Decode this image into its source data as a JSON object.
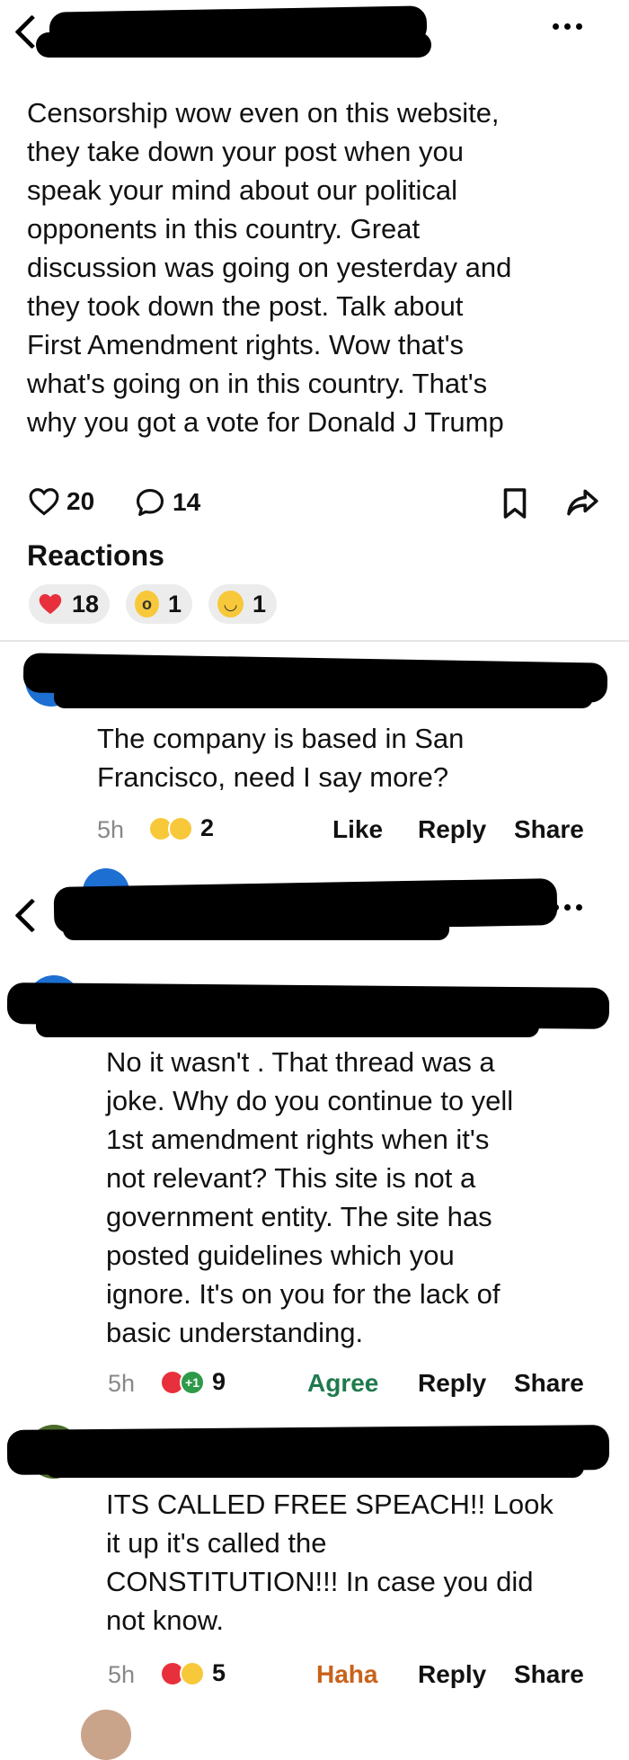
{
  "post": {
    "text": "Censorship wow even on this website,\nthey take down your post when you\nspeak your mind about our political\nopponents in this country. Great\ndiscussion was going on yesterday and\nthey took down the post. Talk about\nFirst Amendment rights. Wow that's\nwhat's going on in this country. That's\nwhy you got a vote for Donald J Trump",
    "likes": "20",
    "comments": "14",
    "icons": [
      "back-icon",
      "more-icon",
      "heart-icon",
      "comment-icon",
      "bookmark-icon",
      "share-icon"
    ]
  },
  "reactions": {
    "title": "Reactions",
    "items": [
      {
        "icon": "heart-icon",
        "count": "18",
        "color": "#e8303c"
      },
      {
        "icon": "wow-emoji-icon",
        "count": "1",
        "color": "#f7c83a"
      },
      {
        "icon": "haha-emoji-icon",
        "count": "1",
        "color": "#f7c83a"
      }
    ]
  },
  "comments": [
    {
      "text": "The company is based in San\nFrancisco, need I say more?",
      "time": "5h",
      "reaction_count": "2",
      "actions": [
        "Like",
        "Reply",
        "Share"
      ]
    },
    {
      "text": "No it wasn't . That thread was a\njoke.  Why do you continue to yell\n1st amendment rights when it's\nnot relevant?  This site is not a\ngovernment entity.  The site has\nposted guidelines which you\nignore.  It's on you for the lack of\nbasic understanding.",
      "time": "5h",
      "reaction_count": "9",
      "reaction_badge": "+1",
      "actions": [
        "Agree",
        "Reply",
        "Share"
      ],
      "primary_color": "#1f7a4d"
    },
    {
      "text": "ITS CALLED FREE SPEACH!! Look\nit up it's called the\nCONSTITUTION!!! In case you did\nnot know.",
      "time": "5h",
      "reaction_count": "5",
      "actions": [
        "Haha",
        "Reply",
        "Share"
      ],
      "primary_color": "#c9621a"
    }
  ],
  "colors": {
    "heart": "#e8303c",
    "emoji": "#f7c83a",
    "blue": "#1d6fd1"
  }
}
